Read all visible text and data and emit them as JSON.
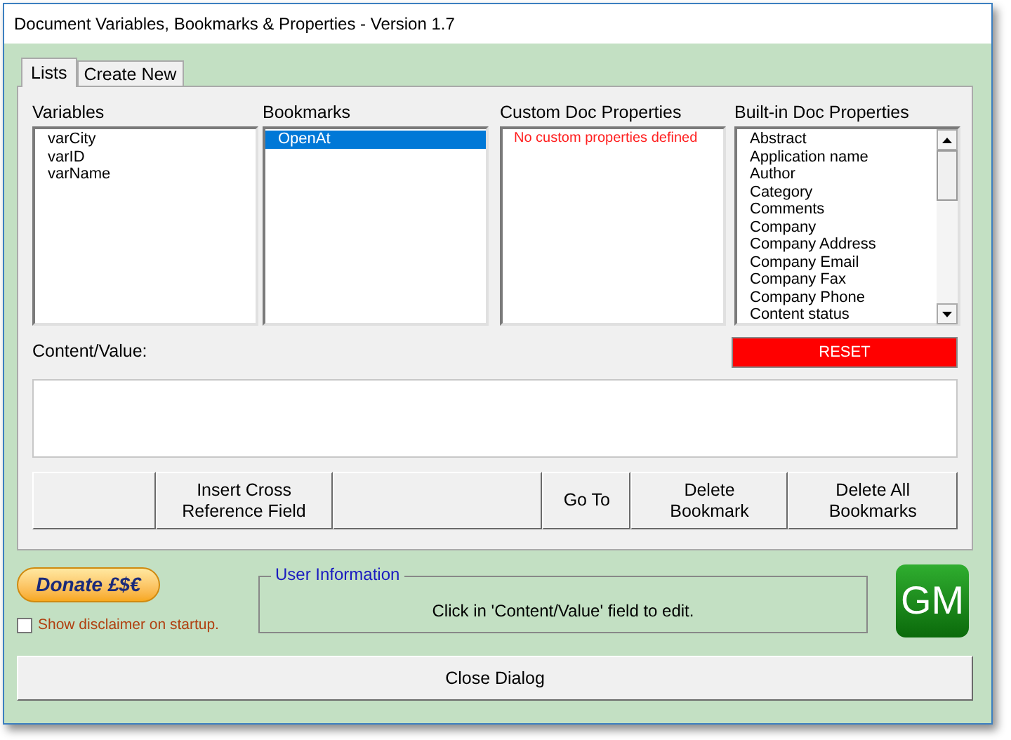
{
  "window": {
    "title": "Document Variables, Bookmarks & Properties - Version 1.7"
  },
  "tabs": [
    {
      "label": "Lists",
      "selected": true
    },
    {
      "label": "Create New",
      "selected": false
    }
  ],
  "lists": [
    {
      "heading": "Variables",
      "kind": "plain",
      "items": [
        {
          "label": "varCity",
          "selected": false
        },
        {
          "label": "varID",
          "selected": false
        },
        {
          "label": "varName",
          "selected": false
        }
      ]
    },
    {
      "heading": "Bookmarks",
      "kind": "plain",
      "items": [
        {
          "label": "OpenAt",
          "selected": true
        }
      ]
    },
    {
      "heading": "Custom Doc Properties",
      "kind": "message",
      "message": "No custom properties defined"
    },
    {
      "heading": "Built-in Doc Properties",
      "kind": "scroll",
      "items": [
        {
          "label": "Abstract",
          "selected": false
        },
        {
          "label": "Application name",
          "selected": false
        },
        {
          "label": "Author",
          "selected": false
        },
        {
          "label": "Category",
          "selected": false
        },
        {
          "label": "Comments",
          "selected": false
        },
        {
          "label": "Company",
          "selected": false
        },
        {
          "label": "Company Address",
          "selected": false
        },
        {
          "label": "Company Email",
          "selected": false
        },
        {
          "label": "Company Fax",
          "selected": false
        },
        {
          "label": "Company Phone",
          "selected": false
        },
        {
          "label": "Content status",
          "selected": false
        }
      ]
    }
  ],
  "content": {
    "label": "Content/Value:"
  },
  "reset_button": "RESET",
  "buttons": [
    {
      "kind": "blank"
    },
    {
      "kind": "text",
      "label": "Insert Cross Reference Field"
    },
    {
      "kind": "blank"
    },
    {
      "kind": "text",
      "label": "Go To"
    },
    {
      "kind": "text",
      "label": "Delete Bookmark"
    },
    {
      "kind": "text",
      "label": "Delete All Bookmarks"
    }
  ],
  "donate": {
    "label": "Donate £$€"
  },
  "disclaimer": {
    "label": "Show disclaimer on startup.",
    "checked": false
  },
  "user_information": {
    "title": "User Information",
    "message": "Click in 'Content/Value' field to edit."
  },
  "logo": "GM",
  "close_button": "Close Dialog"
}
